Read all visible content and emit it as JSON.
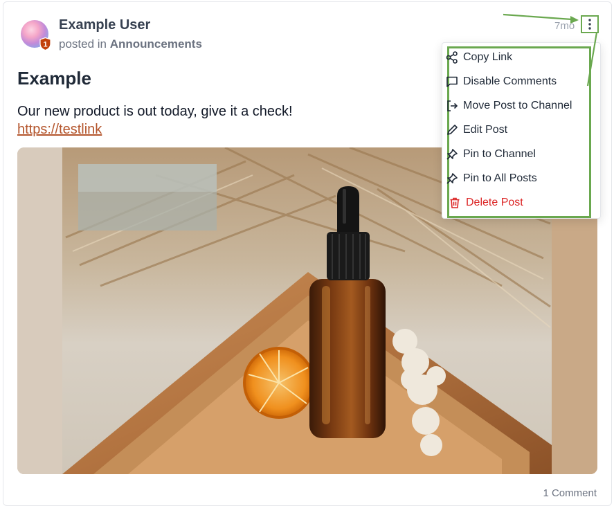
{
  "post": {
    "author": "Example User",
    "posted_in_prefix": "posted in",
    "channel": "Announcements",
    "timestamp": "7mo",
    "badge_count": "1",
    "title": "Example",
    "body": "Our new product is out today, give it a check!",
    "link": "https://testlink",
    "comments_count": "1 Comment"
  },
  "menu": {
    "items": [
      {
        "label": "Copy Link",
        "icon": "share-icon"
      },
      {
        "label": "Disable Comments",
        "icon": "comment-icon"
      },
      {
        "label": "Move Post to Channel",
        "icon": "move-icon"
      },
      {
        "label": "Edit Post",
        "icon": "pencil-icon"
      },
      {
        "label": "Pin to Channel",
        "icon": "pin-icon"
      },
      {
        "label": "Pin to All Posts",
        "icon": "pin-icon"
      },
      {
        "label": "Delete Post",
        "icon": "trash-icon"
      }
    ]
  },
  "colors": {
    "highlight": "#6aa84f",
    "danger": "#dc2626",
    "link": "#b4552c",
    "badge": "#c2410c"
  }
}
